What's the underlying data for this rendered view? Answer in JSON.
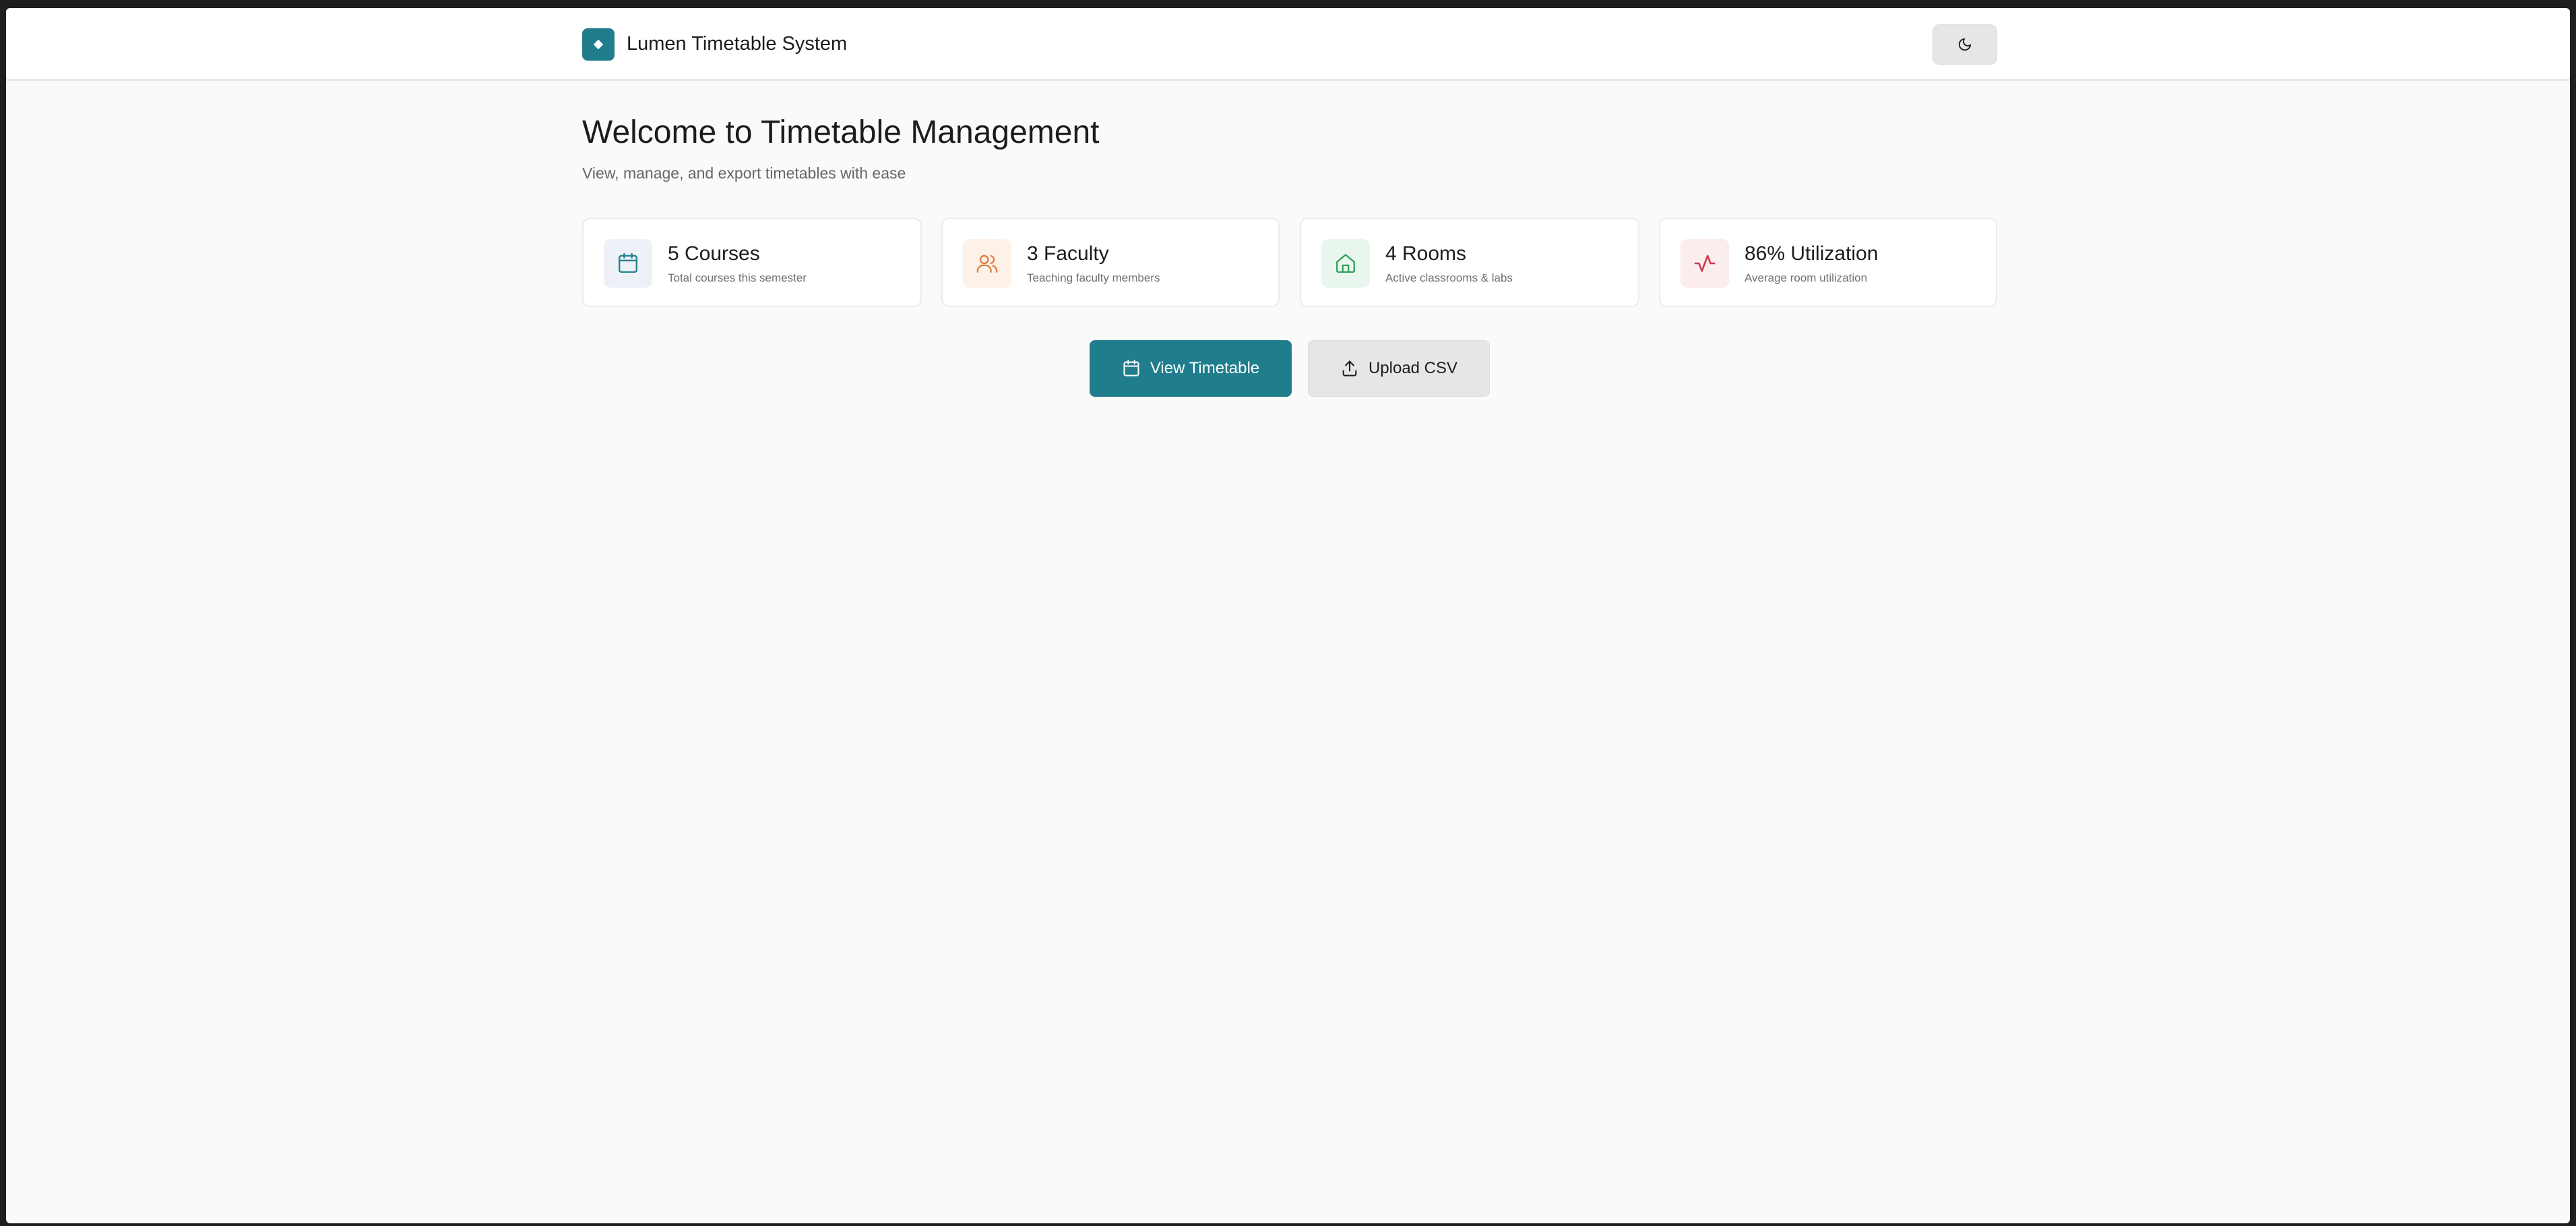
{
  "header": {
    "app_title": "Lumen Timetable System",
    "logo_icon": "diamond-icon",
    "theme_toggle_icon": "moon-icon"
  },
  "main": {
    "title": "Welcome to Timetable Management",
    "subtitle": "View, manage, and export timetables with ease"
  },
  "stats": [
    {
      "value": "5 Courses",
      "label": "Total courses this semester",
      "icon": "calendar-icon",
      "color": "#1f7d8c",
      "bg": "#eef2f8"
    },
    {
      "value": "3 Faculty",
      "label": "Teaching faculty members",
      "icon": "users-icon",
      "color": "#e07b3c",
      "bg": "#fdf1e8"
    },
    {
      "value": "4 Rooms",
      "label": "Active classrooms & labs",
      "icon": "home-icon",
      "color": "#2f9e57",
      "bg": "#e9f6ee"
    },
    {
      "value": "86% Utilization",
      "label": "Average room utilization",
      "icon": "activity-icon",
      "color": "#d0374b",
      "bg": "#fbecee"
    }
  ],
  "actions": {
    "view_timetable": "View Timetable",
    "upload_csv": "Upload CSV"
  },
  "colors": {
    "accent": "#1f7d8c",
    "background": "#fafaf8",
    "surface": "#ffffff"
  }
}
